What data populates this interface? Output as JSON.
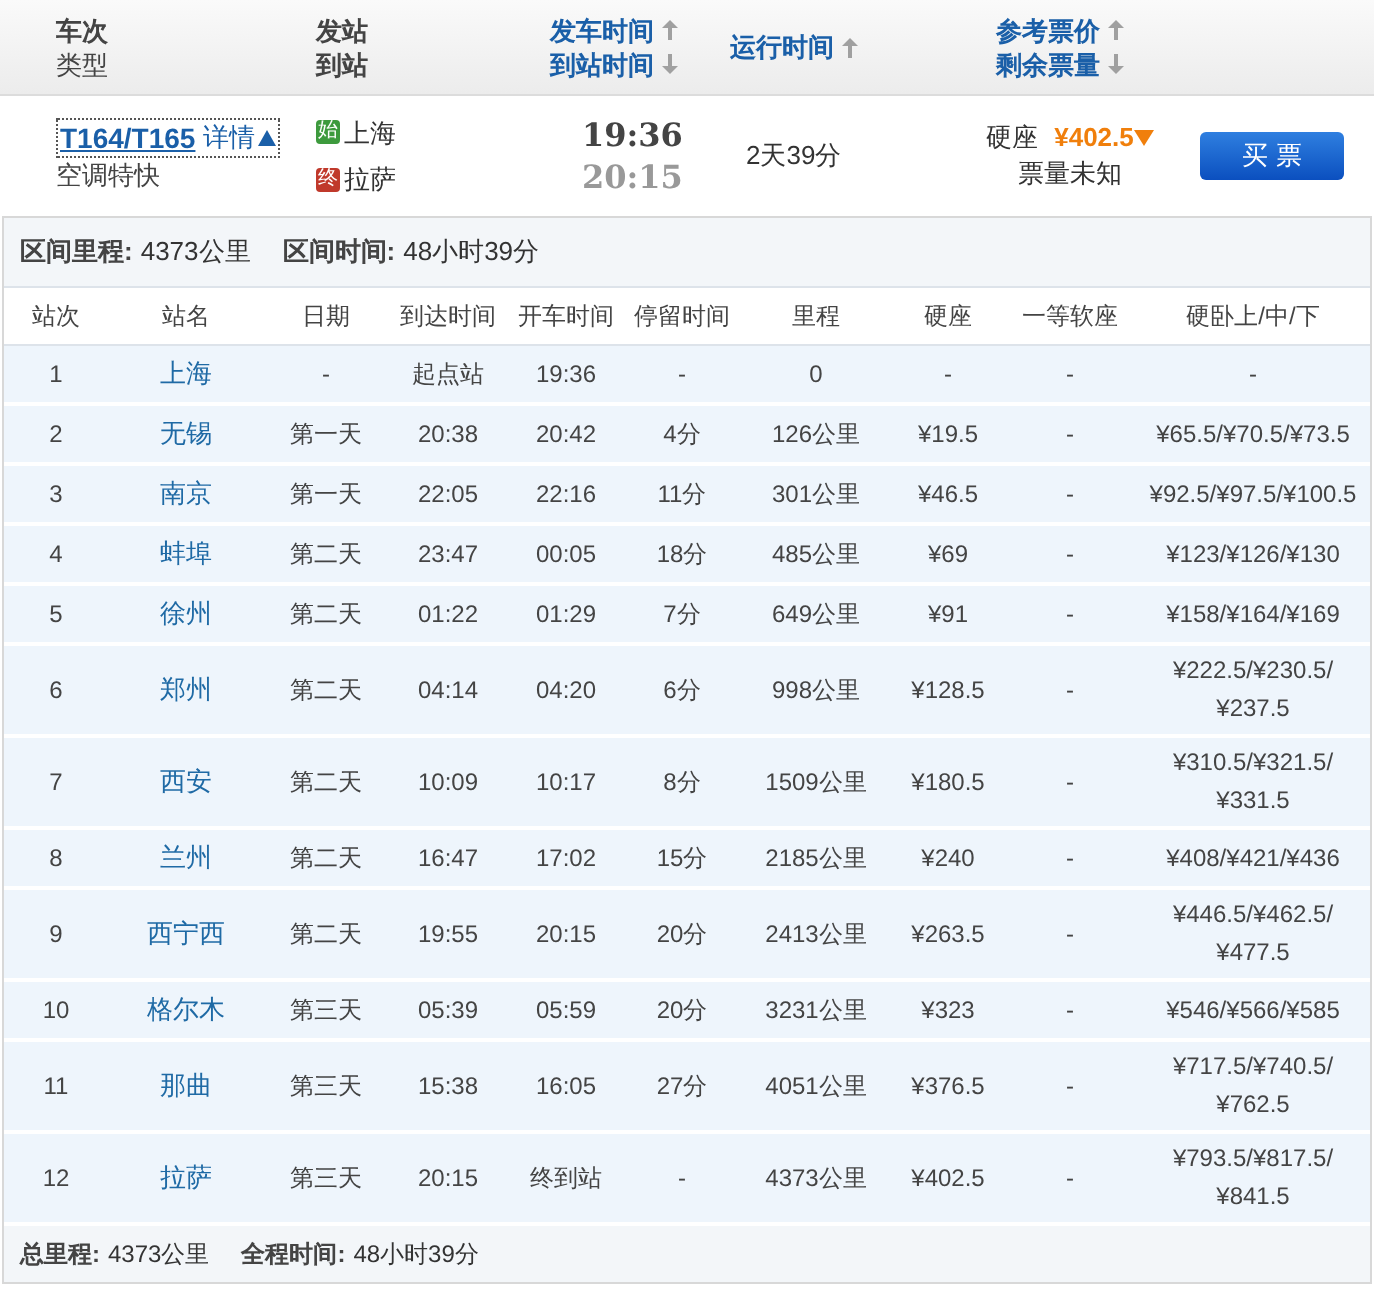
{
  "header": {
    "columns": [
      {
        "lines": [
          "车次",
          "类型"
        ],
        "sortable": false
      },
      {
        "lines": [
          "发站",
          "到站"
        ],
        "sortable": false
      },
      {
        "lines": [
          "发车时间",
          "到站时间"
        ],
        "sortable": true
      },
      {
        "lines": [
          "运行时间"
        ],
        "sortable": true
      },
      {
        "lines": [
          "参考票价",
          "剩余票量"
        ],
        "sortable": true
      }
    ]
  },
  "train": {
    "number": "T164/T165",
    "details_link": "详情",
    "expanded": true,
    "type": "空调特快",
    "from_badge": "始",
    "from": "上海",
    "to_badge": "终",
    "to": "拉萨",
    "depart": "19:36",
    "arrive": "20:15",
    "duration": "2天39分",
    "seat": "硬座",
    "price": "¥402.5",
    "availability": "票量未知",
    "buy": "买 票"
  },
  "summary": [
    {
      "label": "区间里程:",
      "value": "4373公里"
    },
    {
      "label": "区间时间:",
      "value": "48小时39分"
    }
  ],
  "table": {
    "columns": [
      "站次",
      "站名",
      "日期",
      "到达时间",
      "开车时间",
      "停留时间",
      "里程",
      "硬座",
      "一等软座",
      "硬卧上/中/下"
    ],
    "rows": [
      [
        "1",
        "上海",
        "-",
        "起点站",
        "19:36",
        "-",
        "0",
        "-",
        "-",
        "-"
      ],
      [
        "2",
        "无锡",
        "第一天",
        "20:38",
        "20:42",
        "4分",
        "126公里",
        "¥19.5",
        "-",
        "¥65.5/¥70.5/¥73.5"
      ],
      [
        "3",
        "南京",
        "第一天",
        "22:05",
        "22:16",
        "11分",
        "301公里",
        "¥46.5",
        "-",
        "¥92.5/¥97.5/¥100.5"
      ],
      [
        "4",
        "蚌埠",
        "第二天",
        "23:47",
        "00:05",
        "18分",
        "485公里",
        "¥69",
        "-",
        "¥123/¥126/¥130"
      ],
      [
        "5",
        "徐州",
        "第二天",
        "01:22",
        "01:29",
        "7分",
        "649公里",
        "¥91",
        "-",
        "¥158/¥164/¥169"
      ],
      [
        "6",
        "郑州",
        "第二天",
        "04:14",
        "04:20",
        "6分",
        "998公里",
        "¥128.5",
        "-",
        "¥222.5/¥230.5/¥237.5"
      ],
      [
        "7",
        "西安",
        "第二天",
        "10:09",
        "10:17",
        "8分",
        "1509公里",
        "¥180.5",
        "-",
        "¥310.5/¥321.5/¥331.5"
      ],
      [
        "8",
        "兰州",
        "第二天",
        "16:47",
        "17:02",
        "15分",
        "2185公里",
        "¥240",
        "-",
        "¥408/¥421/¥436"
      ],
      [
        "9",
        "西宁西",
        "第二天",
        "19:55",
        "20:15",
        "20分",
        "2413公里",
        "¥263.5",
        "-",
        "¥446.5/¥462.5/¥477.5"
      ],
      [
        "10",
        "格尔木",
        "第三天",
        "05:39",
        "05:59",
        "20分",
        "3231公里",
        "¥323",
        "-",
        "¥546/¥566/¥585"
      ],
      [
        "11",
        "那曲",
        "第三天",
        "15:38",
        "16:05",
        "27分",
        "4051公里",
        "¥376.5",
        "-",
        "¥717.5/¥740.5/¥762.5"
      ],
      [
        "12",
        "拉萨",
        "第三天",
        "20:15",
        "终到站",
        "-",
        "4373公里",
        "¥402.5",
        "-",
        "¥793.5/¥817.5/¥841.5"
      ]
    ]
  },
  "footer": [
    {
      "label": "总里程:",
      "value": "4373公里"
    },
    {
      "label": "全程时间:",
      "value": "48小时39分"
    }
  ]
}
